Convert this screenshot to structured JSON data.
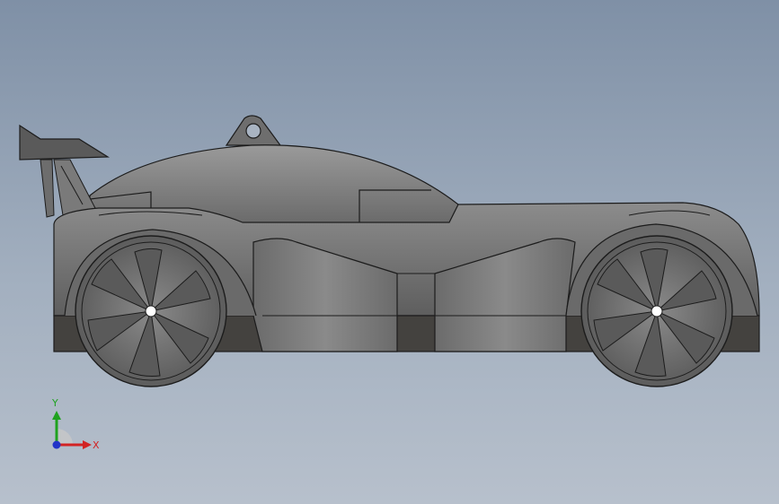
{
  "viewport": {
    "description_hidden": true
  },
  "triad": {
    "y_label": "Y",
    "x_label": "X",
    "colors": {
      "y": "#1fa21f",
      "x": "#d22323",
      "z": "#2233c8"
    }
  },
  "model": {
    "colors": {
      "body_light": "#8a8a8a",
      "body_mid": "#6e6e6e",
      "body_dark": "#4a4a4a",
      "base_dark": "#3f3d3a",
      "outline": "#1c1c1c",
      "wheel": "#777777",
      "wheel_dark": "#595959"
    },
    "icons": [
      "front-wheel-icon",
      "rear-wheel-icon",
      "rear-wing-icon",
      "tow-hook-icon"
    ]
  }
}
